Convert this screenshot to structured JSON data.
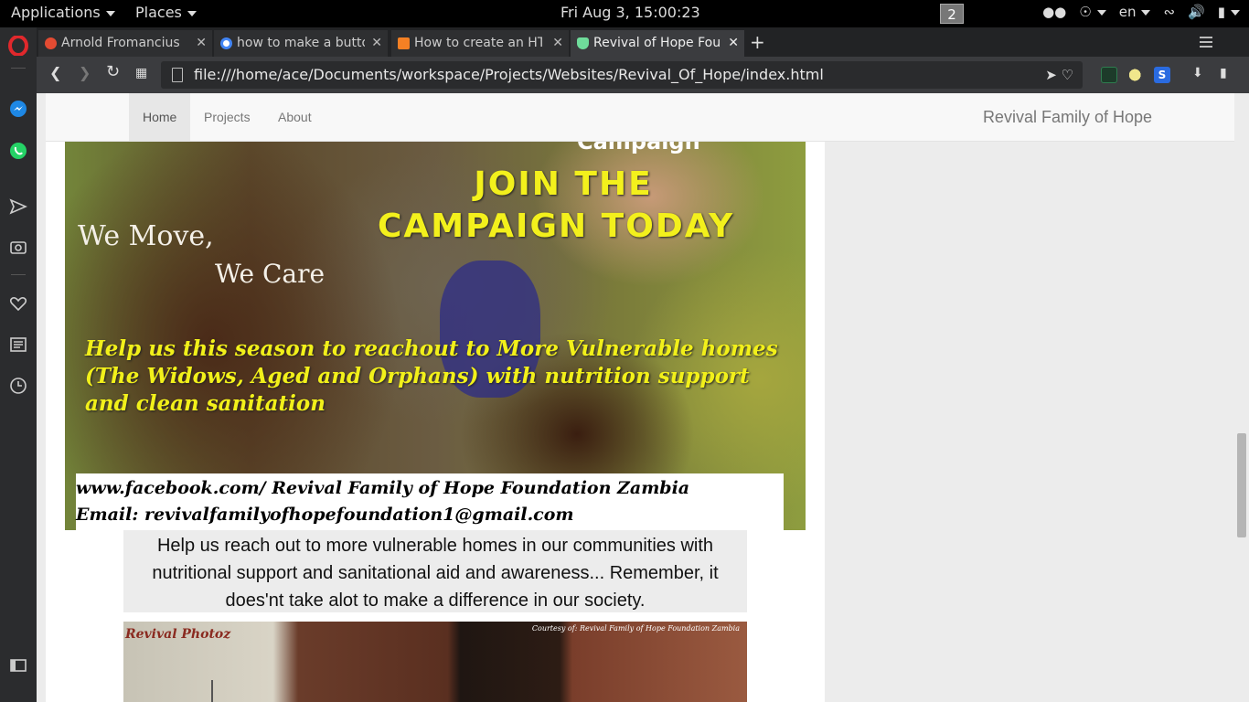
{
  "gnome": {
    "applications": "Applications",
    "places": "Places",
    "clock": "Fri Aug  3, 15:00:23",
    "workspace": "2",
    "language": "en"
  },
  "tabs": [
    {
      "title": "Arnold Fromancius",
      "favicon_color": "#e34b32"
    },
    {
      "title": "how to make a button",
      "favicon_color": "#4285f4"
    },
    {
      "title": "How to create an HTML",
      "favicon_color": "#f48024"
    },
    {
      "title": "Revival of Hope Foundation",
      "favicon_color": "#6fdc9b"
    }
  ],
  "address": {
    "url": "file:///home/ace/Documents/workspace/Projects/Websites/Revival_Of_Hope/index.html"
  },
  "site": {
    "nav": [
      "Home",
      "Projects",
      "About"
    ],
    "brand": "Revival Family of Hope"
  },
  "poster": {
    "top_text": "Campaign",
    "join_line1": "JOIN THE",
    "join_line2": "CAMPAIGN TODAY",
    "we_move": "We Move,",
    "we_care": "We Care",
    "help_text": "Help us this season to reachout to More Vulnerable homes (The Widows, Aged and Orphans) with nutrition support and clean sanitation",
    "facebook": "www.facebook.com/ Revival Family of Hope Foundation Zambia",
    "email": "Email: revivalfamilyofhopefoundation1@gmail.com"
  },
  "caption": "Help us reach out to more vulnerable homes in our communities with nutritional support and sanitational aid and awareness... Remember, it does'nt take alot to make a difference in our society.",
  "photo": {
    "label": "Revival Photoz",
    "courtesy": "Courtesy of: Revival Family of Hope Foundation Zambia"
  },
  "colors": {
    "poster_yellow": "#f3f01c",
    "navbar_bg": "#f8f8f8",
    "active_tab_favicon": "#6fdc9b"
  }
}
